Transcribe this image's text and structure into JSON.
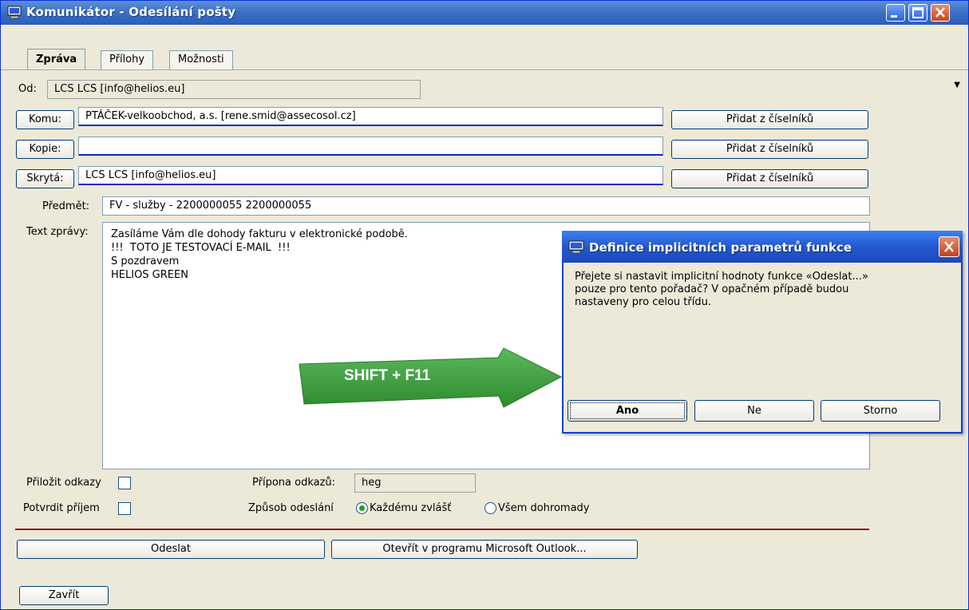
{
  "window": {
    "title": "Komunikátor - Odesílání pošty",
    "icon": "computer-icon"
  },
  "tabs": [
    "Zpráva",
    "Přílohy",
    "Možnosti"
  ],
  "form": {
    "od_label": "Od:",
    "od_value": "LCS LCS [info@helios.eu]",
    "komu_button": "Komu:",
    "komu_value": "PTÁČEK-velkoobchod,  a.s.  [rene.smid@assecosol.cz]",
    "kopie_button": "Kopie:",
    "kopie_value": "",
    "skryta_button": "Skrytá:",
    "skryta_value": "LCS LCS [info@helios.eu]",
    "add_from_catalog": "Přidat z číselníků",
    "predmet_label": "Předmět:",
    "predmet_value": "FV - služby - 2200000055  2200000055",
    "text_label": "Text zprávy:",
    "text_lines": [
      "Zasíláme Vám dle dohody fakturu v elektronické podobě.",
      "",
      "!!!  TOTO JE TESTOVACÍ E-MAIL  !!!",
      "",
      "",
      "S pozdravem",
      "HELIOS GREEN"
    ],
    "prilozit_label": "Přiložit odkazy",
    "potvrdit_label": "Potvrdit příjem",
    "pripona_label": "Přípona odkazů:",
    "pripona_value": "heg",
    "zpusob_label": "Způsob odeslání",
    "radio_each": "Každému zvlášť",
    "radio_all": "Všem dohromady",
    "selected_mode": "Každému zvlášť"
  },
  "actions": {
    "send": "Odeslat",
    "open_outlook": "Otevřít v programu Microsoft Outlook...",
    "close": "Zavřít"
  },
  "annotation": {
    "arrow_text": "SHIFT + F11",
    "color": "#3a9a3a"
  },
  "dialog": {
    "title": "Definice implicitních parametrů funkce",
    "message_lines": [
      "Přejete si nastavit implicitní hodnoty funkce «Odeslat...»",
      "pouze pro tento pořadač? V opačném případě budou",
      "nastaveny pro celou třídu."
    ],
    "buttons": [
      "Ano",
      "Ne",
      "Storno"
    ]
  },
  "colors": {
    "titlebar": "#3b6fc4",
    "separator": "#8b1a1a",
    "field_underline": "#0a2cc8"
  }
}
